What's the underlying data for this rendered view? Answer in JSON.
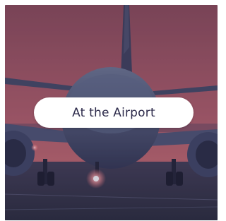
{
  "card": {
    "title": "At the Airport",
    "image_subject": "airplane-on-runway-photo"
  },
  "colors": {
    "sky_top": "#8c4b57",
    "sky_mid": "#b8616b",
    "horizon_glow": "#c06a70",
    "ground": "#2f3547",
    "overlay": "#3b2e55",
    "pill_background": "#ffffff",
    "pill_text": "#2c2a4a"
  }
}
